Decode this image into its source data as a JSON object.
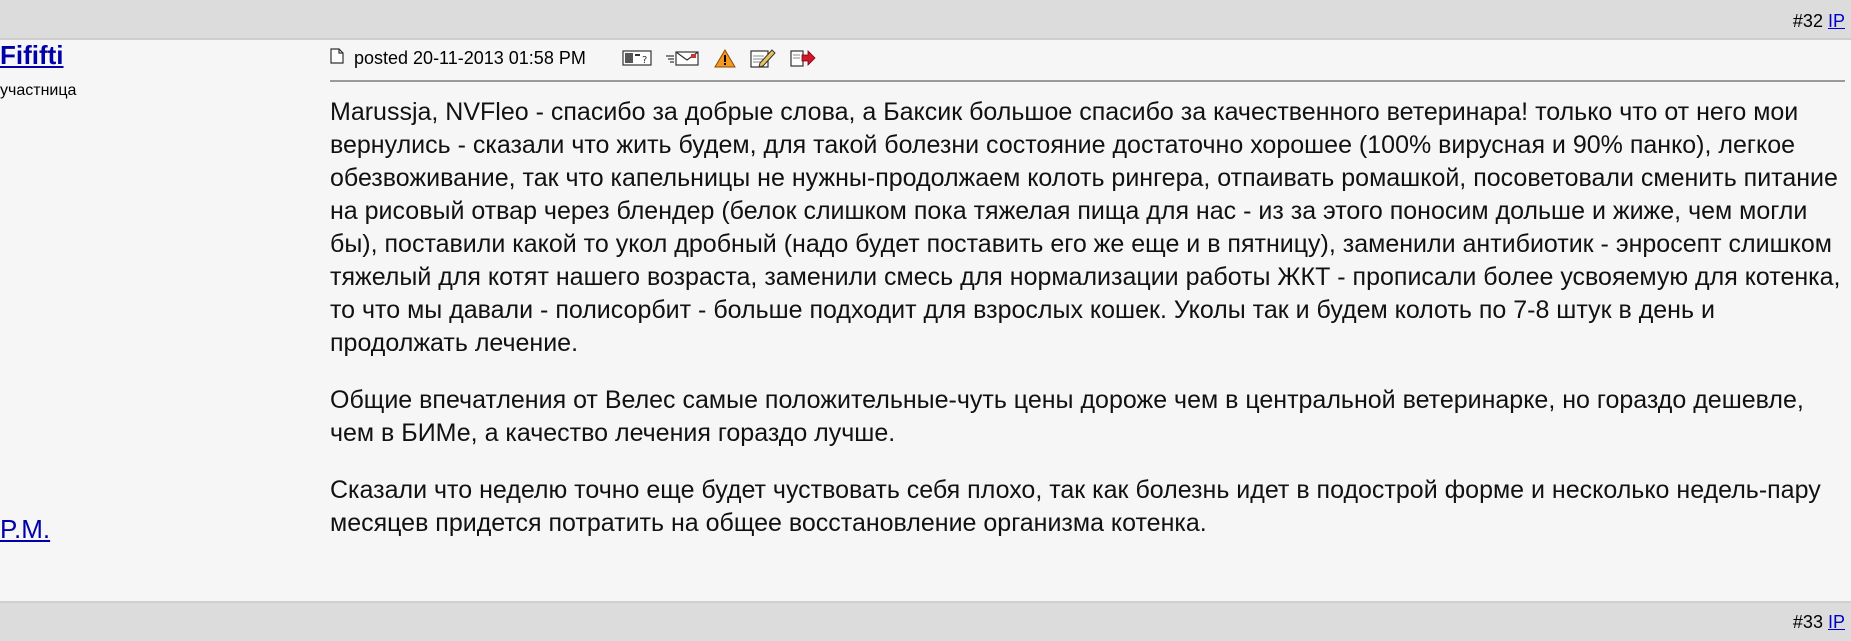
{
  "top_bar": {
    "post_number": "#32",
    "ip_link": "IP"
  },
  "author": {
    "name": "Fififti",
    "rank": "участница",
    "pm_link": "P.M."
  },
  "post": {
    "posted_label": "posted 20-11-2013 01:58 PM",
    "toolbar": {
      "profile_icon": "profile-card-icon",
      "email_icon": "email-icon",
      "report_icon": "warning-icon",
      "edit_icon": "edit-icon",
      "quote_icon": "reply-arrow-icon"
    },
    "paragraphs": [
      "Marussja, NVFleo - спасибо за добрые слова, а Баксик большое спасибо за качественного ветеринара! только что от него мои вернулись - сказали что жить будем, для такой болезни состояние достаточно хорошее (100% вирусная и 90% панко), легкое обезвоживание, так что капельницы не нужны-продолжаем колоть рингера, отпаивать ромашкой, посоветовали сменить питание на рисовый отвар через блендер (белок слишком пока тяжелая пища для нас - из за этого поносим дольше и жиже, чем могли бы), поставили какой то укол дробный (надо будет поставить его же еще и в пятницу), заменили антибиотик - энросепт слишком тяжелый для котят нашего возраста, заменили смесь для нормализации работы ЖКТ - прописали более усвояемую для котенка, то что мы давали - полисорбит - больше подходит для взрослых кошек. Уколы так и будем колоть по 7-8 штук в день и продолжать лечение.",
      "Общие впечатления от Велес самые положительные-чуть цены дороже чем в центральной ветеринарке, но гораздо дешевле, чем в БИМе, а качество лечения гораздо лучше.",
      "Сказали что неделю точно еще будет чуствовать себя плохо, так как болезнь идет в подострой форме и несколько недель-пару месяцев придется потратить на общее восстановление организма котенка."
    ]
  },
  "bottom_bar": {
    "post_number": "#33",
    "ip_link": "IP"
  }
}
